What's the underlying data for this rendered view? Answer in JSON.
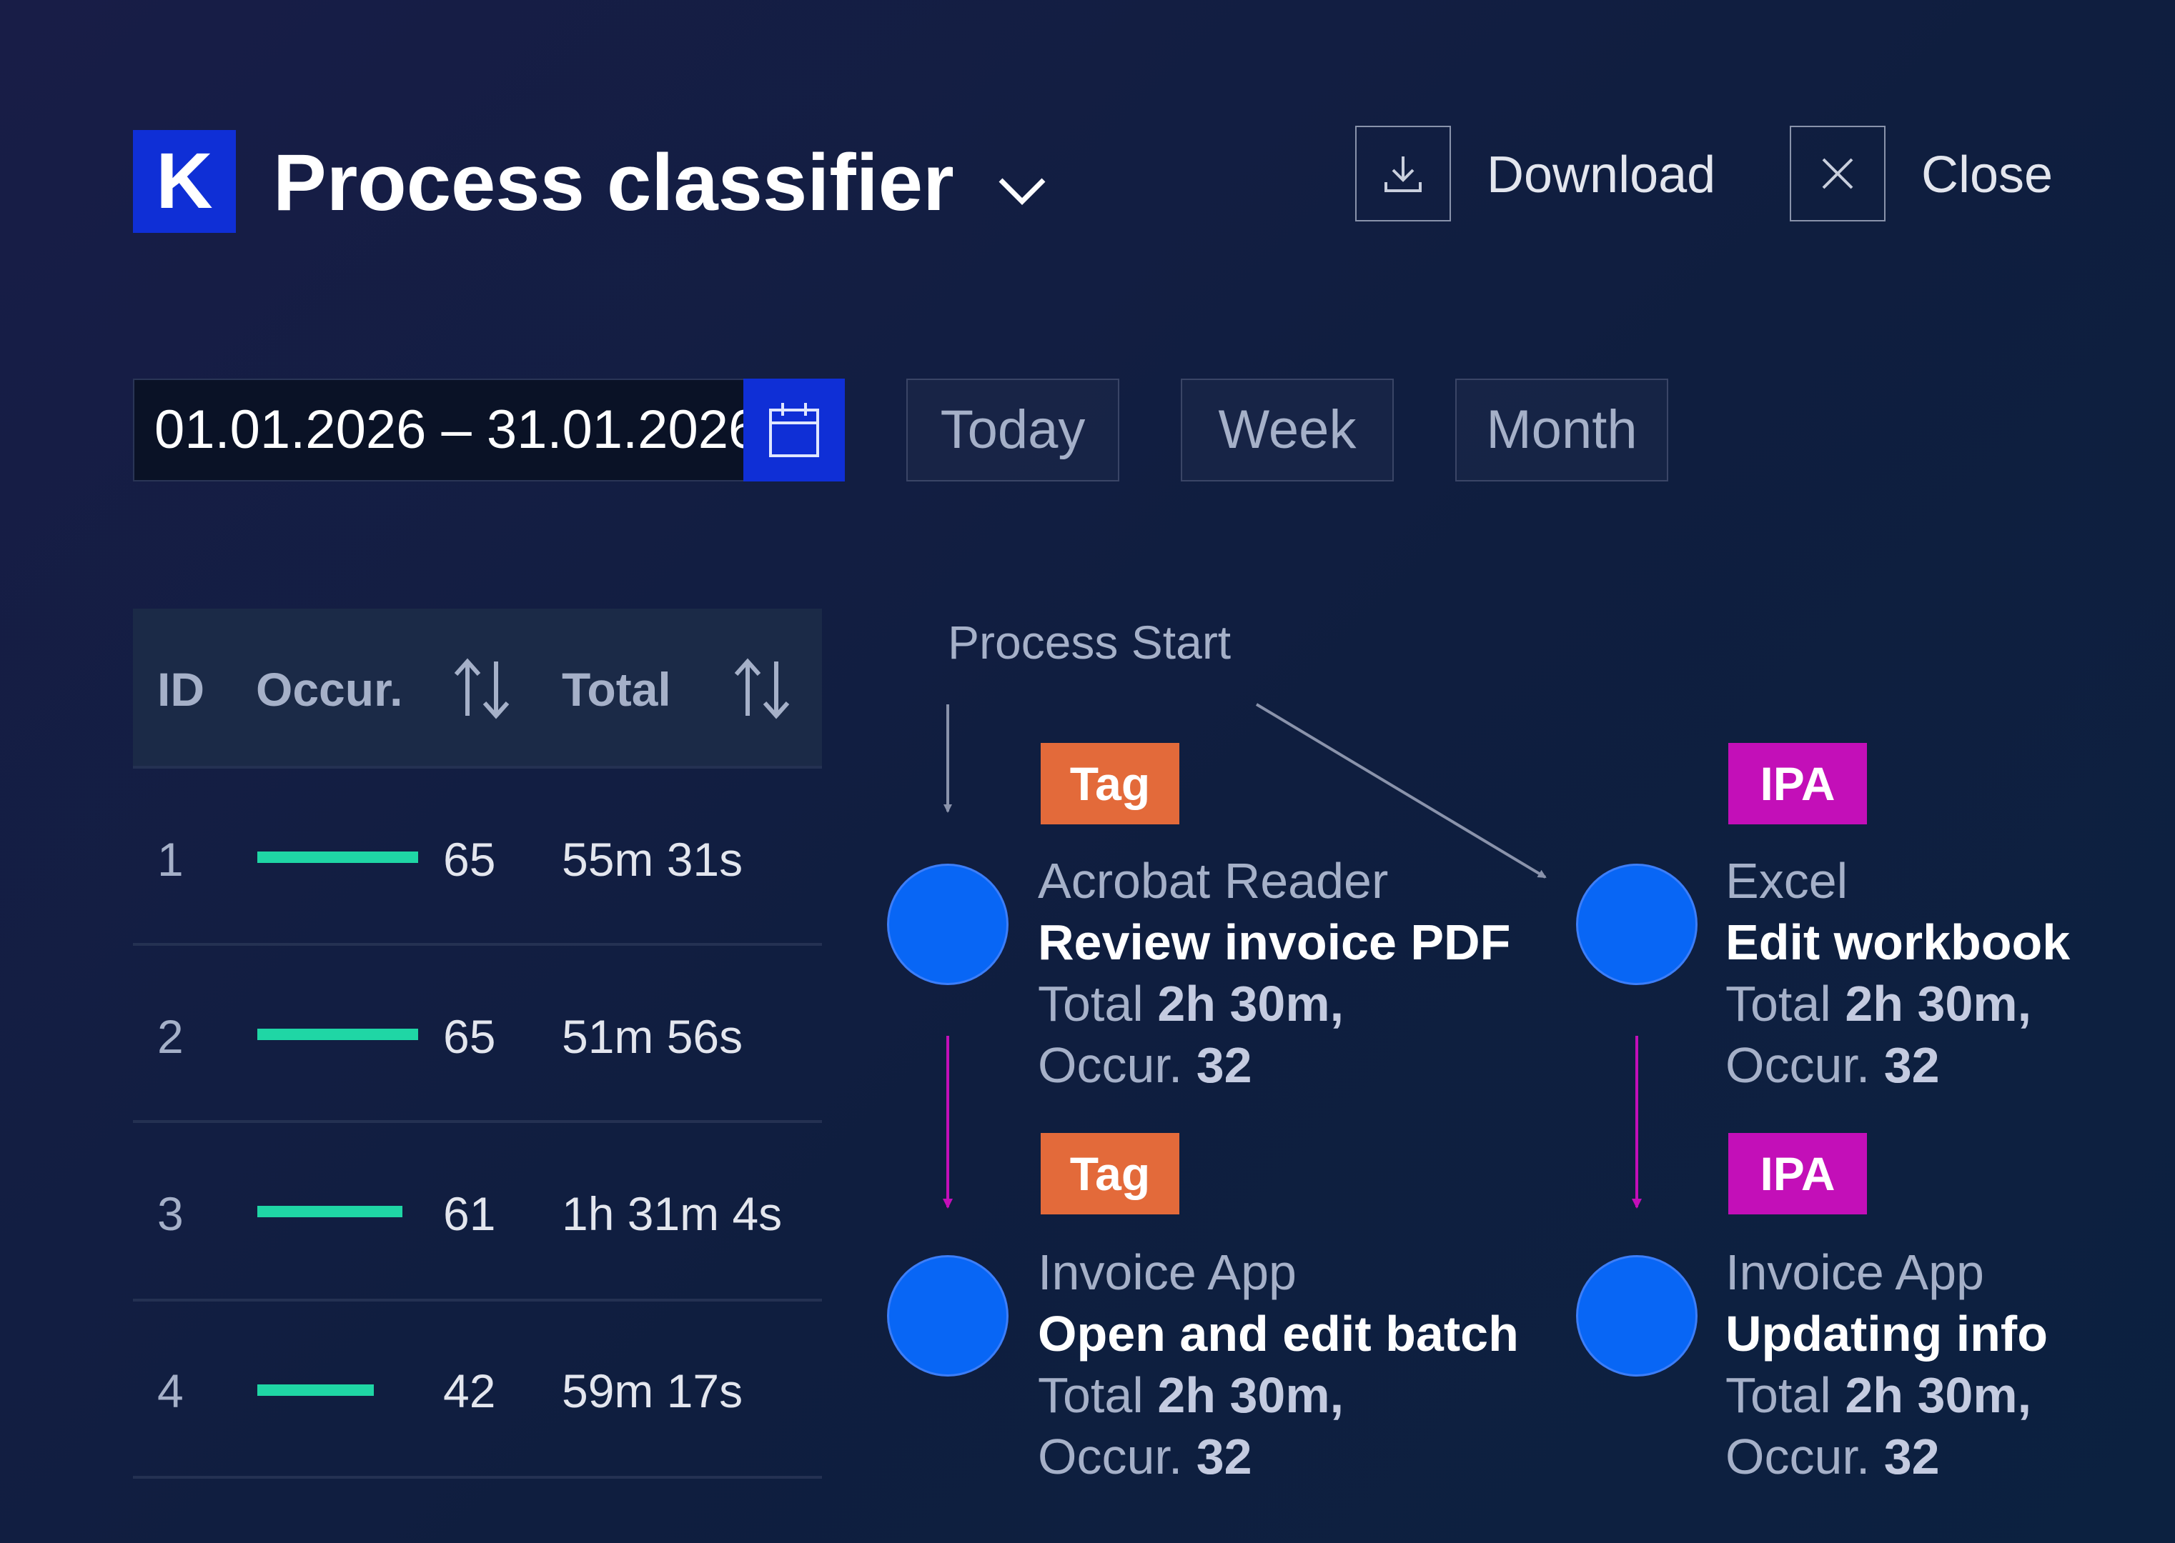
{
  "header": {
    "logo_letter": "K",
    "title": "Process classifier",
    "download_label": "Download",
    "close_label": "Close"
  },
  "date_filter": {
    "range_value": "01.01.2026 – 31.01.2026",
    "presets": [
      "Today",
      "Week",
      "Month"
    ]
  },
  "table": {
    "columns": {
      "id": "ID",
      "occurrences": "Occur.",
      "total": "Total"
    },
    "rows": [
      {
        "id": "1",
        "occurrences": "65",
        "occurrence_level": 0.9,
        "total": "55m 31s"
      },
      {
        "id": "2",
        "occurrences": "65",
        "occurrence_level": 0.9,
        "total": "51m 56s"
      },
      {
        "id": "3",
        "occurrences": "61",
        "occurrence_level": 0.81,
        "total": "1h 31m 4s"
      },
      {
        "id": "4",
        "occurrences": "42",
        "occurrence_level": 0.65,
        "total": "59m 17s"
      }
    ],
    "bar_color": "#1fd6a5"
  },
  "flow": {
    "start_label": "Process Start",
    "steps": [
      {
        "tag": "Tag",
        "tag_color": "#e36a3a",
        "app": "Acrobat Reader",
        "title": "Review invoice PDF",
        "total_prefix": "Total",
        "total": "2h 30m,",
        "occ_prefix": "Occur.",
        "occ": "32"
      },
      {
        "tag": "IPA",
        "tag_color": "#c30fb8",
        "app": "Excel",
        "title": "Edit workbook",
        "total_prefix": "Total",
        "total": "2h 30m,",
        "occ_prefix": "Occur.",
        "occ": "32"
      },
      {
        "tag": "Tag",
        "tag_color": "#e36a3a",
        "app": "Invoice App",
        "title": "Open and edit batch",
        "total_prefix": "Total",
        "total": "2h 30m,",
        "occ_prefix": "Occur.",
        "occ": "32"
      },
      {
        "tag": "IPA",
        "tag_color": "#c30fb8",
        "app": "Invoice App",
        "title": "Updating info",
        "total_prefix": "Total",
        "total": "2h 30m,",
        "occ_prefix": "Occur.",
        "occ": "32"
      }
    ],
    "node_color": "#0866f5",
    "connector_color": "#c30fb8"
  },
  "icons": {
    "title_dropdown": "chevron-down-icon",
    "download": "download-icon",
    "close": "close-icon",
    "calendar": "calendar-icon",
    "sort": "sort-icon"
  }
}
